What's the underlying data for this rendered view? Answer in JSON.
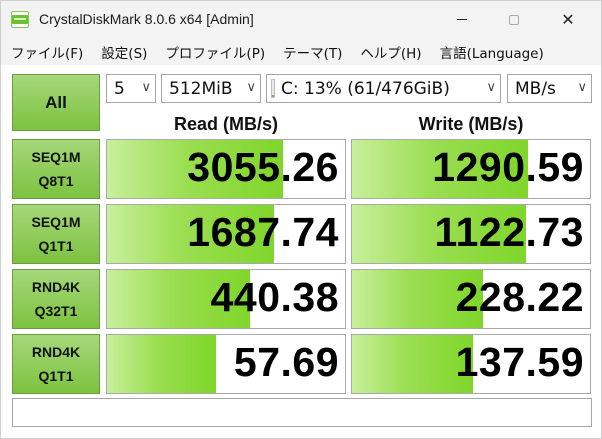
{
  "window": {
    "title": "CrystalDiskMark 8.0.6 x64 [Admin]",
    "close_glyph": "✕"
  },
  "menu": [
    "ファイル(F)",
    "設定(S)",
    "プロファイル(P)",
    "テーマ(T)",
    "ヘルプ(H)",
    "言語(Language)"
  ],
  "controls": {
    "all_label": "All",
    "test_count": "5",
    "test_size": "512MiB",
    "drive": "C: 13% (61/476GiB)",
    "drive_usage_fraction": 0.13,
    "unit": "MB/s",
    "chevron": "∨"
  },
  "columns": {
    "read": "Read (MB/s)",
    "write": "Write (MB/s)"
  },
  "rows": [
    {
      "line1": "SEQ1M",
      "line2": "Q8T1",
      "read": "3055.26",
      "write": "1290.59",
      "read_fill": 0.74,
      "write_fill": 0.74
    },
    {
      "line1": "SEQ1M",
      "line2": "Q1T1",
      "read": "1687.74",
      "write": "1122.73",
      "read_fill": 0.7,
      "write_fill": 0.73
    },
    {
      "line1": "RND4K",
      "line2": "Q32T1",
      "read": "440.38",
      "write": "228.22",
      "read_fill": 0.6,
      "write_fill": 0.55
    },
    {
      "line1": "RND4K",
      "line2": "Q1T1",
      "read": "57.69",
      "write": "137.59",
      "read_fill": 0.46,
      "write_fill": 0.51
    }
  ],
  "comment": "",
  "colors": {
    "accent_green": "#7cc33f",
    "bar_green": "#7fd62a",
    "bar_light": "#c9ef9c"
  },
  "icons": {
    "app": "crystaldiskmark-app-icon",
    "minimize": "minimize-icon",
    "maximize": "maximize-icon",
    "close": "close-icon",
    "dropdown": "chevron-down-icon"
  }
}
